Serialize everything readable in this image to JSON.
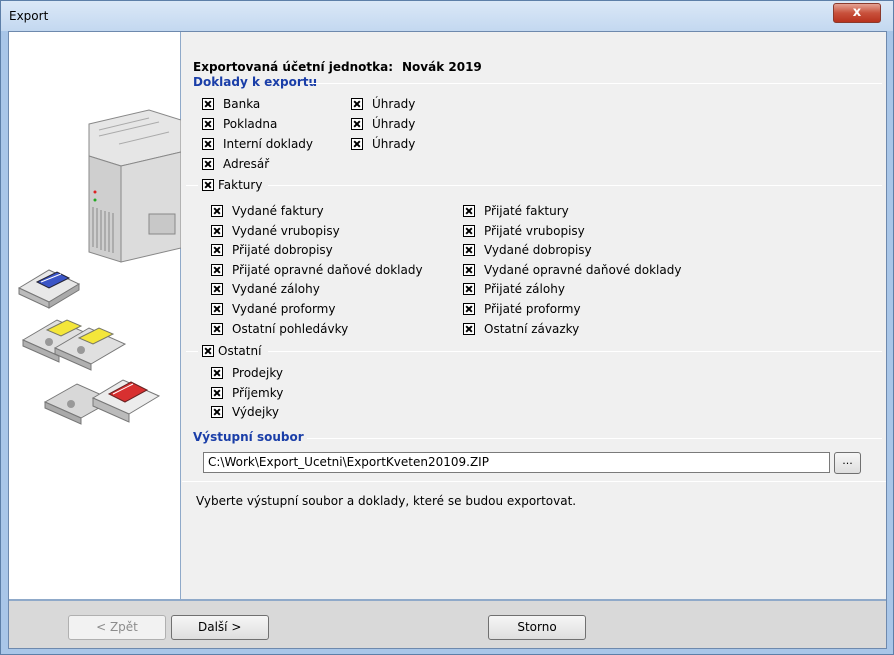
{
  "window": {
    "title": "Export",
    "close_glyph": "x"
  },
  "entity": {
    "label": "Exportovaná účetní jednotka:",
    "name": "Novák 2019"
  },
  "sections": {
    "doklady_header": "Doklady k exportu",
    "faktury_group": "Faktury",
    "ostatni_group": "Ostatní",
    "output_header": "Výstupní soubor"
  },
  "doklady": [
    {
      "label": "Banka",
      "checked": true,
      "uhrady": "Úhrady",
      "uhrady_checked": true
    },
    {
      "label": "Pokladna",
      "checked": true,
      "uhrady": "Úhrady",
      "uhrady_checked": true
    },
    {
      "label": "Interní doklady",
      "checked": true,
      "uhrady": "Úhrady",
      "uhrady_checked": true
    },
    {
      "label": "Adresář",
      "checked": true
    }
  ],
  "faktury": {
    "checked": true,
    "left": [
      "Vydané faktury",
      "Vydané vrubopisy",
      "Přijaté dobropisy",
      "Přijaté opravné daňové doklady",
      "Vydané zálohy",
      "Vydané proformy",
      "Ostatní pohledávky"
    ],
    "right": [
      "Přijaté faktury",
      "Přijaté vrubopisy",
      "Vydané dobropisy",
      "Vydané opravné daňové doklady",
      "Přijaté zálohy",
      "Přijaté proformy",
      "Ostatní závazky"
    ]
  },
  "ostatni": {
    "checked": true,
    "items": [
      "Prodejky",
      "Příjemky",
      "Výdejky"
    ]
  },
  "output": {
    "path": "C:\\Work\\Export_Ucetni\\ExportKveten20109.ZIP",
    "browse_label": "..."
  },
  "hint": "Vyberte výstupní soubor a doklady, které se budou exportovat.",
  "buttons": {
    "back": "< Zpět",
    "next": "Další >",
    "cancel": "Storno"
  },
  "icons": [
    "computer-illustration",
    "floppy-disk-blue",
    "floppy-disk-yellow",
    "floppy-disk-yellow",
    "floppy-disk-red"
  ]
}
